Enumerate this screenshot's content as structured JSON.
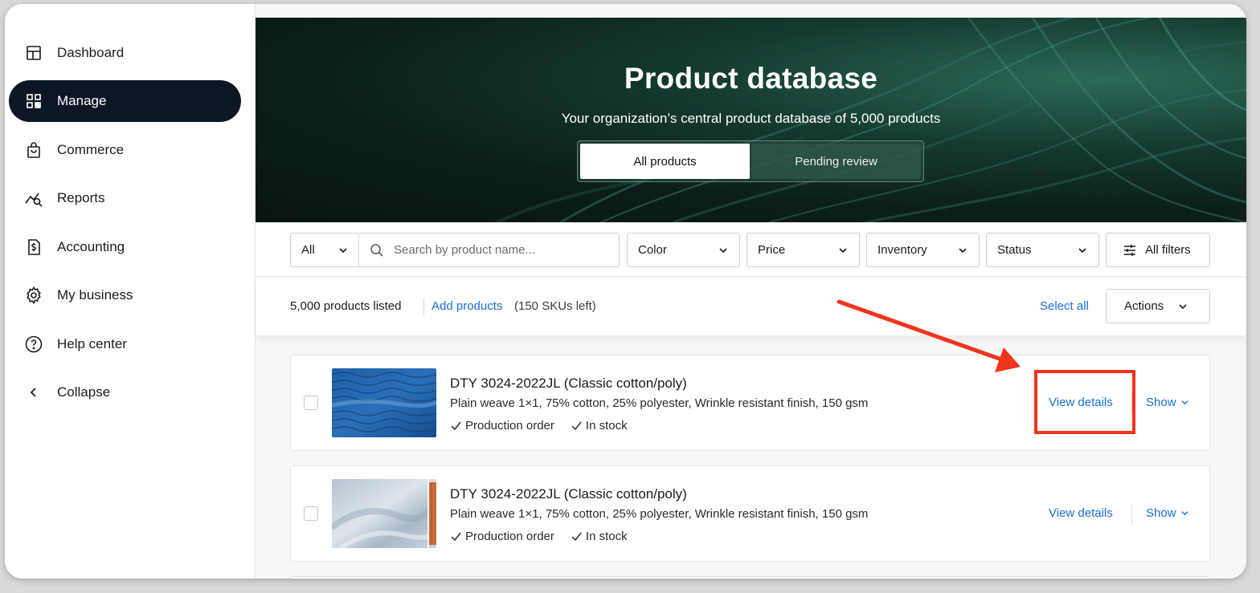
{
  "sidebar": {
    "items": [
      {
        "label": "Dashboard",
        "icon": "layout-icon",
        "active": false
      },
      {
        "label": "Manage",
        "icon": "qr-grid-icon",
        "active": true
      },
      {
        "label": "Commerce",
        "icon": "shopping-bag-icon",
        "active": false
      },
      {
        "label": "Reports",
        "icon": "trend-search-icon",
        "active": false
      },
      {
        "label": "Accounting",
        "icon": "dollar-file-icon",
        "active": false
      },
      {
        "label": "My business",
        "icon": "gear-icon",
        "active": false
      },
      {
        "label": "Help center",
        "icon": "help-circle-icon",
        "active": false
      },
      {
        "label": "Collapse",
        "icon": "chevron-left-icon",
        "active": false
      }
    ]
  },
  "hero": {
    "title": "Product database",
    "subtitle": "Your organization’s central product database of 5,000 products",
    "tabs": [
      {
        "label": "All products",
        "selected": true
      },
      {
        "label": "Pending review",
        "selected": false
      }
    ]
  },
  "filters": {
    "scope": "All",
    "search_placeholder": "Search by product name...",
    "color": "Color",
    "price": "Price",
    "inventory": "Inventory",
    "status": "Status",
    "all_filters": "All filters"
  },
  "summary": {
    "count": "5,000 products listed",
    "add_products": "Add products",
    "skus_left": "(150 SKUs left)",
    "select_all": "Select all",
    "actions": "Actions"
  },
  "products": [
    {
      "title": "DTY 3024-2022JL (Classic cotton/poly)",
      "description": "Plain weave 1×1, 75% cotton, 25% polyester, Wrinkle resistant finish, 150 gsm",
      "tags": [
        "Production order",
        "In stock"
      ],
      "view_label": "View details",
      "show_label": "Show",
      "swatch": "blue-fabric"
    },
    {
      "title": "DTY 3024-2022JL (Classic cotton/poly)",
      "description": "Plain weave 1×1, 75% cotton, 25% polyester, Wrinkle resistant finish, 150 gsm",
      "tags": [
        "Production order",
        "In stock"
      ],
      "view_label": "View details",
      "show_label": "Show",
      "swatch": "grey-fabric"
    }
  ],
  "colors": {
    "accent_link": "#1a6fd6",
    "nav_active": "#0d1624",
    "annotation_red": "#f2331b",
    "hero_green": "#14392f"
  }
}
